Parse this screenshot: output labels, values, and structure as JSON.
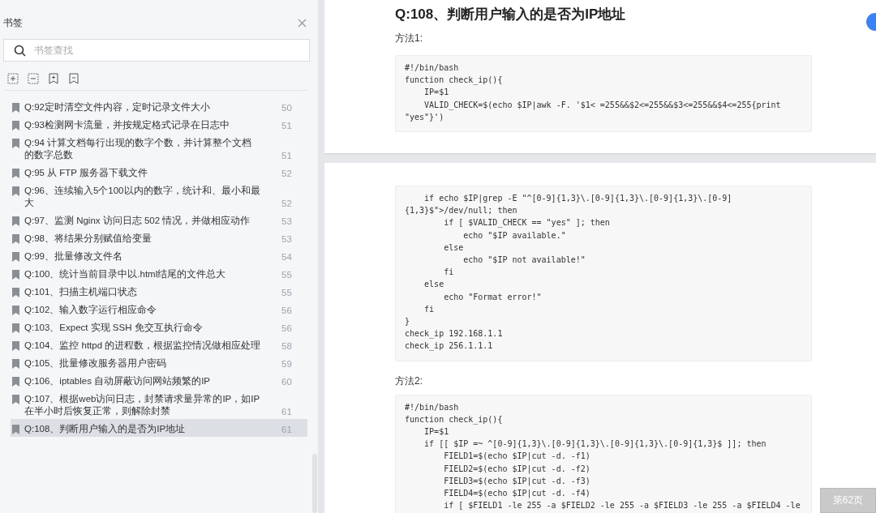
{
  "sidebar": {
    "title": "书签",
    "search": {
      "placeholder": "书签查找"
    },
    "bookmarks": [
      {
        "title": "Q:92定时清空文件内容，定时记录文件大小",
        "page": "50",
        "selected": false
      },
      {
        "title": "Q:93检测网卡流量，并按规定格式记录在日志中",
        "page": "51",
        "selected": false
      },
      {
        "title": "Q:94 计算文档每行出现的数字个数，并计算整个文档的数字总数",
        "page": "51",
        "selected": false
      },
      {
        "title": "Q:95 从 FTP 服务器下载文件",
        "page": "52",
        "selected": false
      },
      {
        "title": "Q:96、连续输入5个100以内的数字，统计和、最小和最大",
        "page": "52",
        "selected": false
      },
      {
        "title": "Q:97、监测 Nginx 访问日志 502 情况，并做相应动作",
        "page": "53",
        "selected": false
      },
      {
        "title": "Q:98、将结果分别赋值给变量",
        "page": "53",
        "selected": false
      },
      {
        "title": "Q:99、批量修改文件名",
        "page": "54",
        "selected": false
      },
      {
        "title": "Q:100、统计当前目录中以.html结尾的文件总大",
        "page": "55",
        "selected": false
      },
      {
        "title": "Q:101、扫描主机端口状态",
        "page": "55",
        "selected": false
      },
      {
        "title": "Q:102、输入数字运行相应命令",
        "page": "56",
        "selected": false
      },
      {
        "title": "Q:103、Expect 实现 SSH 免交互执行命令",
        "page": "56",
        "selected": false
      },
      {
        "title": "Q:104、监控 httpd 的进程数，根据监控情况做相应处理",
        "page": "58",
        "selected": false
      },
      {
        "title": "Q:105、批量修改服务器用户密码",
        "page": "59",
        "selected": false
      },
      {
        "title": "Q:106、iptables 自动屏蔽访问网站频繁的IP",
        "page": "60",
        "selected": false
      },
      {
        "title": "Q:107、根据web访问日志，封禁请求量异常的IP，如IP在半小时后恢复正常，则解除封禁",
        "page": "61",
        "selected": false
      },
      {
        "title": "Q:108、判断用户输入的是否为IP地址",
        "page": "61",
        "selected": true
      }
    ]
  },
  "document": {
    "pages": [
      {
        "blocks": [
          {
            "kind": "heading",
            "text": "Q:108、判断用户输入的是否为IP地址"
          },
          {
            "kind": "text",
            "text": "方法1:"
          },
          {
            "kind": "code",
            "lines": [
              "#!/bin/bash",
              "function check_ip(){",
              "    IP=$1",
              "    VALID_CHECK=$(echo $IP|awk -F. '$1< =255&&$2<=255&&$3<=255&&$4<=255{print",
              "\"yes\"}')"
            ]
          }
        ]
      },
      {
        "blocks": [
          {
            "kind": "code",
            "lines": [
              "    if echo $IP|grep -E \"^[0-9]{1,3}\\.[0-9]{1,3}\\.[0-9]{1,3}\\.[0-9]",
              "{1,3}$\">/dev/null; then",
              "        if [ $VALID_CHECK == \"yes\" ]; then",
              "            echo \"$IP available.\"",
              "        else",
              "            echo \"$IP not available!\"",
              "        fi",
              "    else",
              "        echo \"Format error!\"",
              "    fi",
              "}",
              "check_ip 192.168.1.1",
              "check_ip 256.1.1.1"
            ]
          },
          {
            "kind": "text",
            "text": "方法2:"
          },
          {
            "kind": "code",
            "lines": [
              "#!/bin/bash",
              "function check_ip(){",
              "    IP=$1",
              "    if [[ $IP =~ ^[0-9]{1,3}\\.[0-9]{1,3}\\.[0-9]{1,3}\\.[0-9]{1,3}$ ]]; then",
              "        FIELD1=$(echo $IP|cut -d. -f1)",
              "        FIELD2=$(echo $IP|cut -d. -f2)",
              "        FIELD3=$(echo $IP|cut -d. -f3)",
              "        FIELD4=$(echo $IP|cut -d. -f4)",
              "        if [ $FIELD1 -le 255 -a $FIELD2 -le 255 -a $FIELD3 -le 255 -a $FIELD4 -le"
            ]
          }
        ]
      }
    ]
  },
  "page_indicator": "第62页"
}
